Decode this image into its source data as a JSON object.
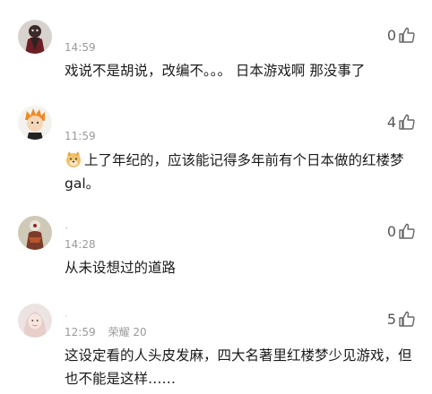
{
  "comments": [
    {
      "name": "",
      "time": "14:59",
      "level": "",
      "likes": "0",
      "text": "戏说不是胡说，改编不。。。 日本游戏啊 那没事了",
      "has_emoji": false
    },
    {
      "name": "",
      "time": "11:59",
      "level": "",
      "likes": "4",
      "text": "上了年纪的，应该能记得多年前有个日本做的红楼梦gal。",
      "has_emoji": true,
      "emoji_icon": "doge-icon"
    },
    {
      "name": "ˉ",
      "time": "14:28",
      "level": "",
      "likes": "0",
      "text": "从未设想过的道路",
      "has_emoji": false
    },
    {
      "name": "·",
      "time": "12:59",
      "level": "荣耀 20",
      "likes": "5",
      "text": "这设定看的人头皮发麻，四大名著里红楼梦少见游戏，但也不能是这样……",
      "has_emoji": false
    }
  ],
  "icons": {
    "like": "thumbs-up-icon"
  },
  "colors": {
    "meta": "#9a9a9a",
    "text": "#1a1a1a"
  }
}
